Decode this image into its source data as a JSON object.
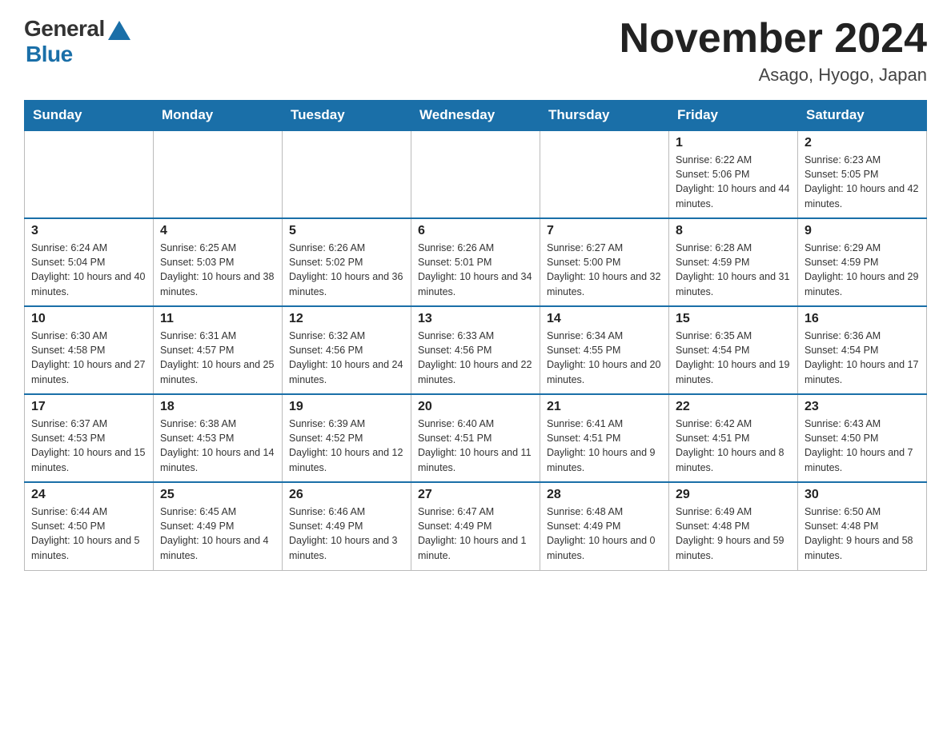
{
  "header": {
    "logo_general": "General",
    "logo_blue": "Blue",
    "month_title": "November 2024",
    "location": "Asago, Hyogo, Japan"
  },
  "weekdays": [
    "Sunday",
    "Monday",
    "Tuesday",
    "Wednesday",
    "Thursday",
    "Friday",
    "Saturday"
  ],
  "weeks": [
    [
      {
        "day": "",
        "info": ""
      },
      {
        "day": "",
        "info": ""
      },
      {
        "day": "",
        "info": ""
      },
      {
        "day": "",
        "info": ""
      },
      {
        "day": "",
        "info": ""
      },
      {
        "day": "1",
        "info": "Sunrise: 6:22 AM\nSunset: 5:06 PM\nDaylight: 10 hours and 44 minutes."
      },
      {
        "day": "2",
        "info": "Sunrise: 6:23 AM\nSunset: 5:05 PM\nDaylight: 10 hours and 42 minutes."
      }
    ],
    [
      {
        "day": "3",
        "info": "Sunrise: 6:24 AM\nSunset: 5:04 PM\nDaylight: 10 hours and 40 minutes."
      },
      {
        "day": "4",
        "info": "Sunrise: 6:25 AM\nSunset: 5:03 PM\nDaylight: 10 hours and 38 minutes."
      },
      {
        "day": "5",
        "info": "Sunrise: 6:26 AM\nSunset: 5:02 PM\nDaylight: 10 hours and 36 minutes."
      },
      {
        "day": "6",
        "info": "Sunrise: 6:26 AM\nSunset: 5:01 PM\nDaylight: 10 hours and 34 minutes."
      },
      {
        "day": "7",
        "info": "Sunrise: 6:27 AM\nSunset: 5:00 PM\nDaylight: 10 hours and 32 minutes."
      },
      {
        "day": "8",
        "info": "Sunrise: 6:28 AM\nSunset: 4:59 PM\nDaylight: 10 hours and 31 minutes."
      },
      {
        "day": "9",
        "info": "Sunrise: 6:29 AM\nSunset: 4:59 PM\nDaylight: 10 hours and 29 minutes."
      }
    ],
    [
      {
        "day": "10",
        "info": "Sunrise: 6:30 AM\nSunset: 4:58 PM\nDaylight: 10 hours and 27 minutes."
      },
      {
        "day": "11",
        "info": "Sunrise: 6:31 AM\nSunset: 4:57 PM\nDaylight: 10 hours and 25 minutes."
      },
      {
        "day": "12",
        "info": "Sunrise: 6:32 AM\nSunset: 4:56 PM\nDaylight: 10 hours and 24 minutes."
      },
      {
        "day": "13",
        "info": "Sunrise: 6:33 AM\nSunset: 4:56 PM\nDaylight: 10 hours and 22 minutes."
      },
      {
        "day": "14",
        "info": "Sunrise: 6:34 AM\nSunset: 4:55 PM\nDaylight: 10 hours and 20 minutes."
      },
      {
        "day": "15",
        "info": "Sunrise: 6:35 AM\nSunset: 4:54 PM\nDaylight: 10 hours and 19 minutes."
      },
      {
        "day": "16",
        "info": "Sunrise: 6:36 AM\nSunset: 4:54 PM\nDaylight: 10 hours and 17 minutes."
      }
    ],
    [
      {
        "day": "17",
        "info": "Sunrise: 6:37 AM\nSunset: 4:53 PM\nDaylight: 10 hours and 15 minutes."
      },
      {
        "day": "18",
        "info": "Sunrise: 6:38 AM\nSunset: 4:53 PM\nDaylight: 10 hours and 14 minutes."
      },
      {
        "day": "19",
        "info": "Sunrise: 6:39 AM\nSunset: 4:52 PM\nDaylight: 10 hours and 12 minutes."
      },
      {
        "day": "20",
        "info": "Sunrise: 6:40 AM\nSunset: 4:51 PM\nDaylight: 10 hours and 11 minutes."
      },
      {
        "day": "21",
        "info": "Sunrise: 6:41 AM\nSunset: 4:51 PM\nDaylight: 10 hours and 9 minutes."
      },
      {
        "day": "22",
        "info": "Sunrise: 6:42 AM\nSunset: 4:51 PM\nDaylight: 10 hours and 8 minutes."
      },
      {
        "day": "23",
        "info": "Sunrise: 6:43 AM\nSunset: 4:50 PM\nDaylight: 10 hours and 7 minutes."
      }
    ],
    [
      {
        "day": "24",
        "info": "Sunrise: 6:44 AM\nSunset: 4:50 PM\nDaylight: 10 hours and 5 minutes."
      },
      {
        "day": "25",
        "info": "Sunrise: 6:45 AM\nSunset: 4:49 PM\nDaylight: 10 hours and 4 minutes."
      },
      {
        "day": "26",
        "info": "Sunrise: 6:46 AM\nSunset: 4:49 PM\nDaylight: 10 hours and 3 minutes."
      },
      {
        "day": "27",
        "info": "Sunrise: 6:47 AM\nSunset: 4:49 PM\nDaylight: 10 hours and 1 minute."
      },
      {
        "day": "28",
        "info": "Sunrise: 6:48 AM\nSunset: 4:49 PM\nDaylight: 10 hours and 0 minutes."
      },
      {
        "day": "29",
        "info": "Sunrise: 6:49 AM\nSunset: 4:48 PM\nDaylight: 9 hours and 59 minutes."
      },
      {
        "day": "30",
        "info": "Sunrise: 6:50 AM\nSunset: 4:48 PM\nDaylight: 9 hours and 58 minutes."
      }
    ]
  ]
}
